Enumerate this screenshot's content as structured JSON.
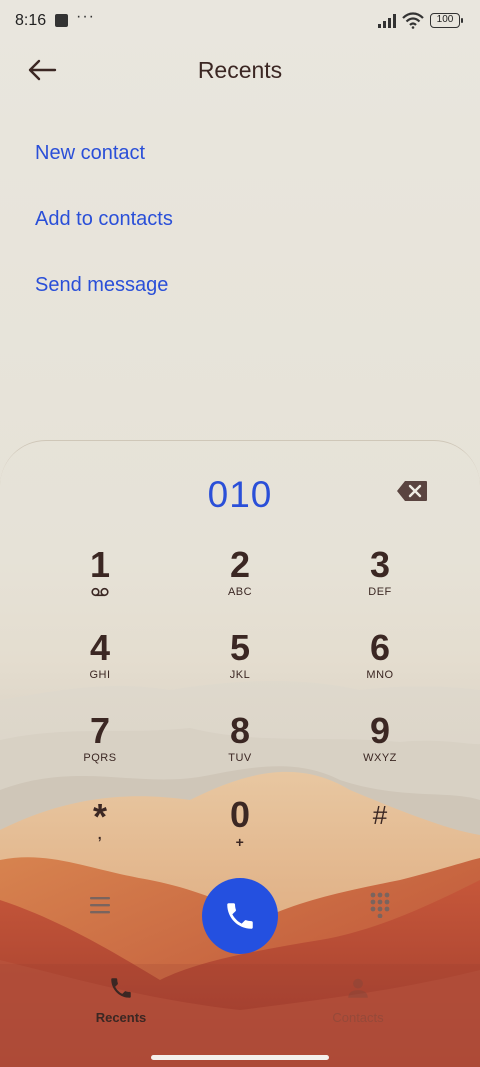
{
  "status_bar": {
    "time": "8:16",
    "more_indicator": "···",
    "battery": "100"
  },
  "header": {
    "title": "Recents",
    "back_icon": "arrow-left-icon"
  },
  "actions": {
    "new_contact": "New contact",
    "add_to_contacts": "Add to contacts",
    "send_message": "Send message"
  },
  "dialer": {
    "number": "010",
    "keys": [
      {
        "digit": "1",
        "letters": ""
      },
      {
        "digit": "2",
        "letters": "ABC"
      },
      {
        "digit": "3",
        "letters": "DEF"
      },
      {
        "digit": "4",
        "letters": "GHI"
      },
      {
        "digit": "5",
        "letters": "JKL"
      },
      {
        "digit": "6",
        "letters": "MNO"
      },
      {
        "digit": "7",
        "letters": "PQRS"
      },
      {
        "digit": "8",
        "letters": "TUV"
      },
      {
        "digit": "9",
        "letters": "WXYZ"
      },
      {
        "digit": "*",
        "letters": ","
      },
      {
        "digit": "0",
        "letters": "+"
      },
      {
        "digit": "#",
        "letters": ""
      }
    ],
    "call_color": "#2450e0"
  },
  "bottom_nav": {
    "recents": "Recents",
    "contacts": "Contacts"
  },
  "colors": {
    "accent": "#2a4fd8",
    "text": "#3b2723"
  }
}
